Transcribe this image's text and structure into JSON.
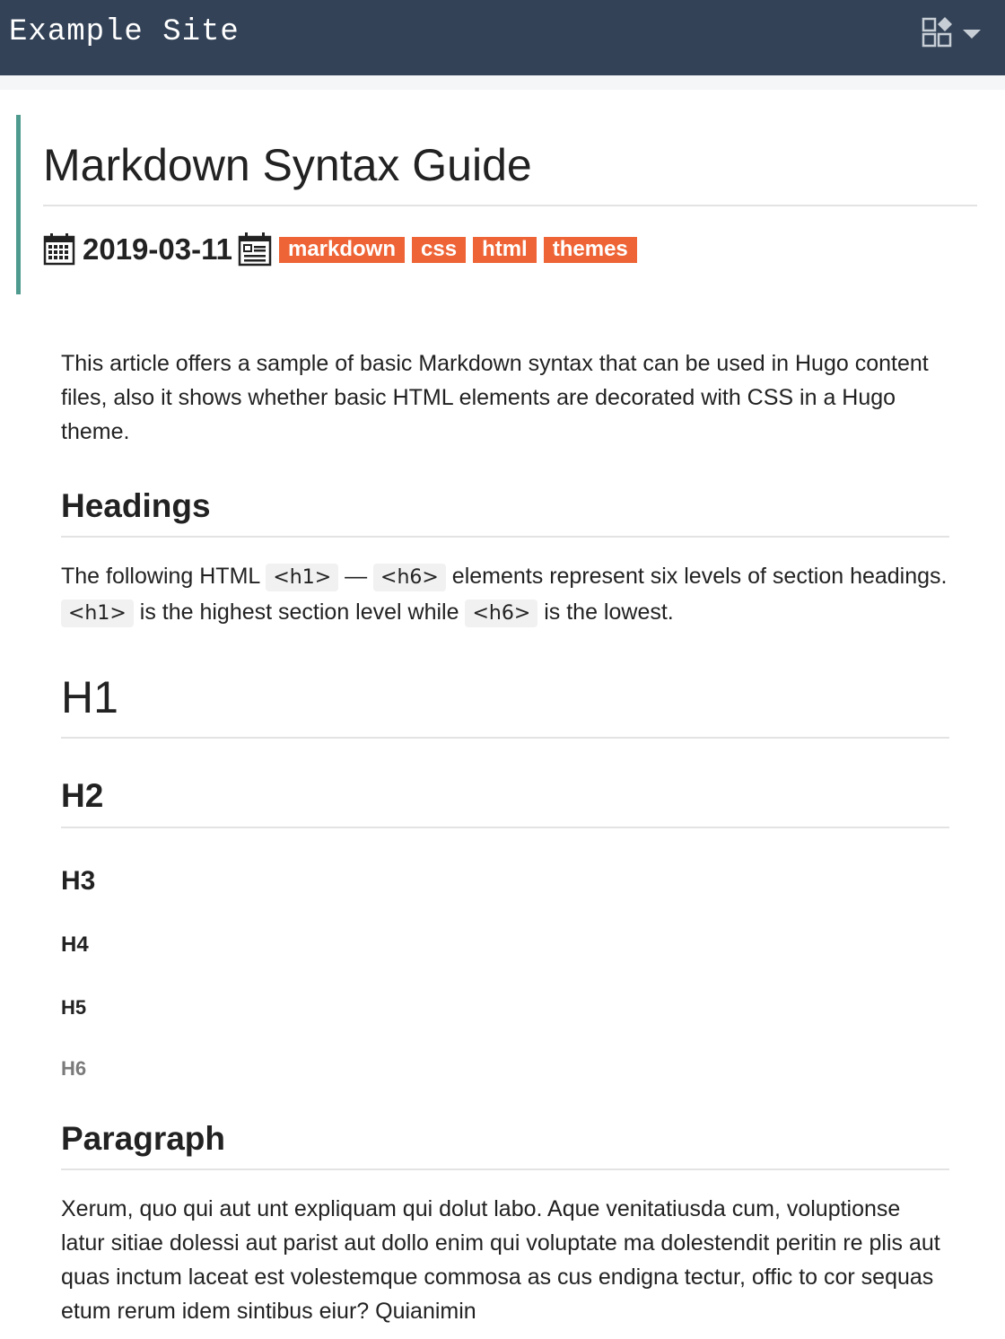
{
  "site": {
    "title": "Example Site"
  },
  "nav": {
    "menu_icon": "apps-grid-icon",
    "dropdown_icon": "caret-down-icon"
  },
  "post": {
    "title": "Markdown Syntax Guide",
    "date": "2019-03-11",
    "date_icon": "calendar-icon",
    "tags_icon": "tag-list-icon",
    "tags": [
      "markdown",
      "css",
      "html",
      "themes"
    ]
  },
  "content": {
    "intro": "This article offers a sample of basic Markdown syntax that can be used in Hugo content files, also it shows whether basic HTML elements are decorated with CSS in a Hugo theme.",
    "headings_title": "Headings",
    "headings_text": {
      "p1": "The following HTML ",
      "code1": "<h1>",
      "p2": " — ",
      "code2": "<h6>",
      "p3": " elements represent six levels of section headings. ",
      "code3": "<h1>",
      "p4": " is the highest section level while ",
      "code4": "<h6>",
      "p5": " is the lowest."
    },
    "demo": {
      "h1": "H1",
      "h2": "H2",
      "h3": "H3",
      "h4": "H4",
      "h5": "H5",
      "h6": "H6"
    },
    "paragraph_title": "Paragraph",
    "paragraph_text": "Xerum, quo qui aut unt expliquam qui dolut labo. Aque venitatiusda cum, voluptionse latur sitiae dolessi aut parist aut dollo enim qui voluptate ma dolestendit peritin re plis aut quas inctum laceat est volestemque commosa as cus endigna tectur, offic to cor sequas etum rerum idem sintibus eiur? Quianimin"
  },
  "colors": {
    "navbar": "#334257",
    "accent_border": "#4e9a8e",
    "tag_bg": "#ee6436"
  }
}
